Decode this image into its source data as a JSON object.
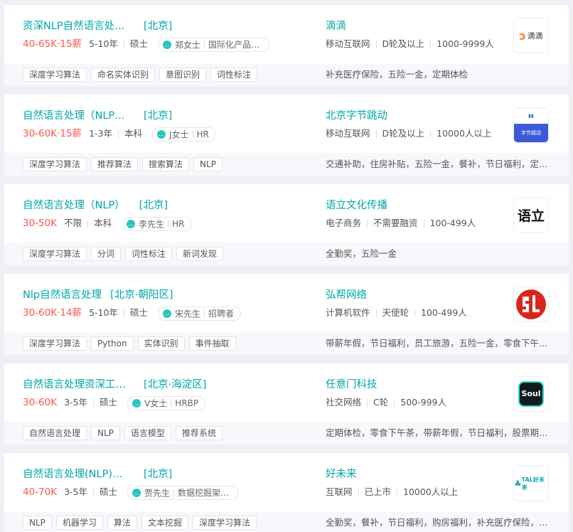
{
  "jobs": [
    {
      "title": "资深NLP自然语言处理工程师",
      "location": "[北京]",
      "salary": "40-65K·15薪",
      "experience": "5-10年",
      "degree": "硕士",
      "recruiter_name": "郑女士",
      "recruiter_role": "国际化产品经理",
      "tags": [
        "深度学习算法",
        "命名实体识别",
        "意图识别",
        "词性标注"
      ],
      "company": "滴滴",
      "company_info": [
        "移动互联网",
        "D轮及以上",
        "1000-9999人"
      ],
      "welfare": "补充医疗保险，五险一金，定期体检",
      "logo": "didi-logo",
      "logo_text": "滴滴"
    },
    {
      "title": "自然语言处理（NLP）算法工程师",
      "location": "[北京]",
      "salary": "30-60K·15薪",
      "experience": "1-3年",
      "degree": "本科",
      "recruiter_name": "J女士",
      "recruiter_role": "HR",
      "tags": [
        "深度学习算法",
        "推荐算法",
        "搜索算法",
        "NLP"
      ],
      "company": "北京字节跳动",
      "company_info": [
        "移动互联网",
        "D轮及以上",
        "10000人以上"
      ],
      "welfare": "交通补助，住房补贴，五险一金，餐补，节日福利，定期体检",
      "logo": "bytedance-logo",
      "logo_text": "字节跳动"
    },
    {
      "title": "自然语言处理（NLP）",
      "location": "[北京]",
      "salary": "30-50K",
      "experience": "不限",
      "degree": "本科",
      "recruiter_name": "李先生",
      "recruiter_role": "HR",
      "tags": [
        "深度学习算法",
        "分词",
        "词性标注",
        "新词发现"
      ],
      "company": "语立文化传播",
      "company_info": [
        "电子商务",
        "不需要融资",
        "100-499人"
      ],
      "welfare": "全勤奖，五险一金",
      "logo": "yuli-logo",
      "logo_text": "语立"
    },
    {
      "title": "Nlp自然语言处理",
      "location": "[北京·朝阳区]",
      "salary": "30-60K·14薪",
      "experience": "5-10年",
      "degree": "硕士",
      "recruiter_name": "宋先生",
      "recruiter_role": "招聘者",
      "tags": [
        "深度学习算法",
        "Python",
        "实体识别",
        "事件抽取"
      ],
      "company": "弘帮网络",
      "company_info": [
        "计算机软件",
        "天使轮",
        "100-499人"
      ],
      "welfare": "带薪年假，节日福利，员工旅游，五险一金，零食下午茶，定期体检",
      "logo": "hongbang-logo",
      "logo_text": ""
    },
    {
      "title": "自然语言处理资深工程师",
      "location": "[北京·海淀区]",
      "salary": "30-60K",
      "experience": "3-5年",
      "degree": "硕士",
      "recruiter_name": "V女士",
      "recruiter_role": "HRBP",
      "tags": [
        "自然语言处理",
        "NLP",
        "语言模型",
        "推荐系统"
      ],
      "company": "任意门科技",
      "company_info": [
        "社交网络",
        "C轮",
        "500-999人"
      ],
      "welfare": "定期体检，零食下午茶，带薪年假，节日福利，股票期权，五险一金",
      "logo": "soul-logo",
      "logo_text": "Soul"
    },
    {
      "title": "自然语言处理(NLP)工程师",
      "location": "[北京]",
      "salary": "40-70K",
      "experience": "3-5年",
      "degree": "硕士",
      "recruiter_name": "贾先生",
      "recruiter_role": "数据挖掘架构师",
      "tags": [
        "NLP",
        "机器学习",
        "算法",
        "文本挖掘",
        "深度学习算法"
      ],
      "company": "好未来",
      "company_info": [
        "互联网",
        "已上市",
        "10000人以上"
      ],
      "welfare": "全勤奖，餐补，节日福利，购房福利，补充医疗保险，带薪年假",
      "logo": "tal-logo",
      "logo_text": "TAL好未来"
    }
  ],
  "colors": {
    "accent": "#00a6a7",
    "salary": "#fe574a",
    "tag_bg": "#f7f8fb"
  }
}
